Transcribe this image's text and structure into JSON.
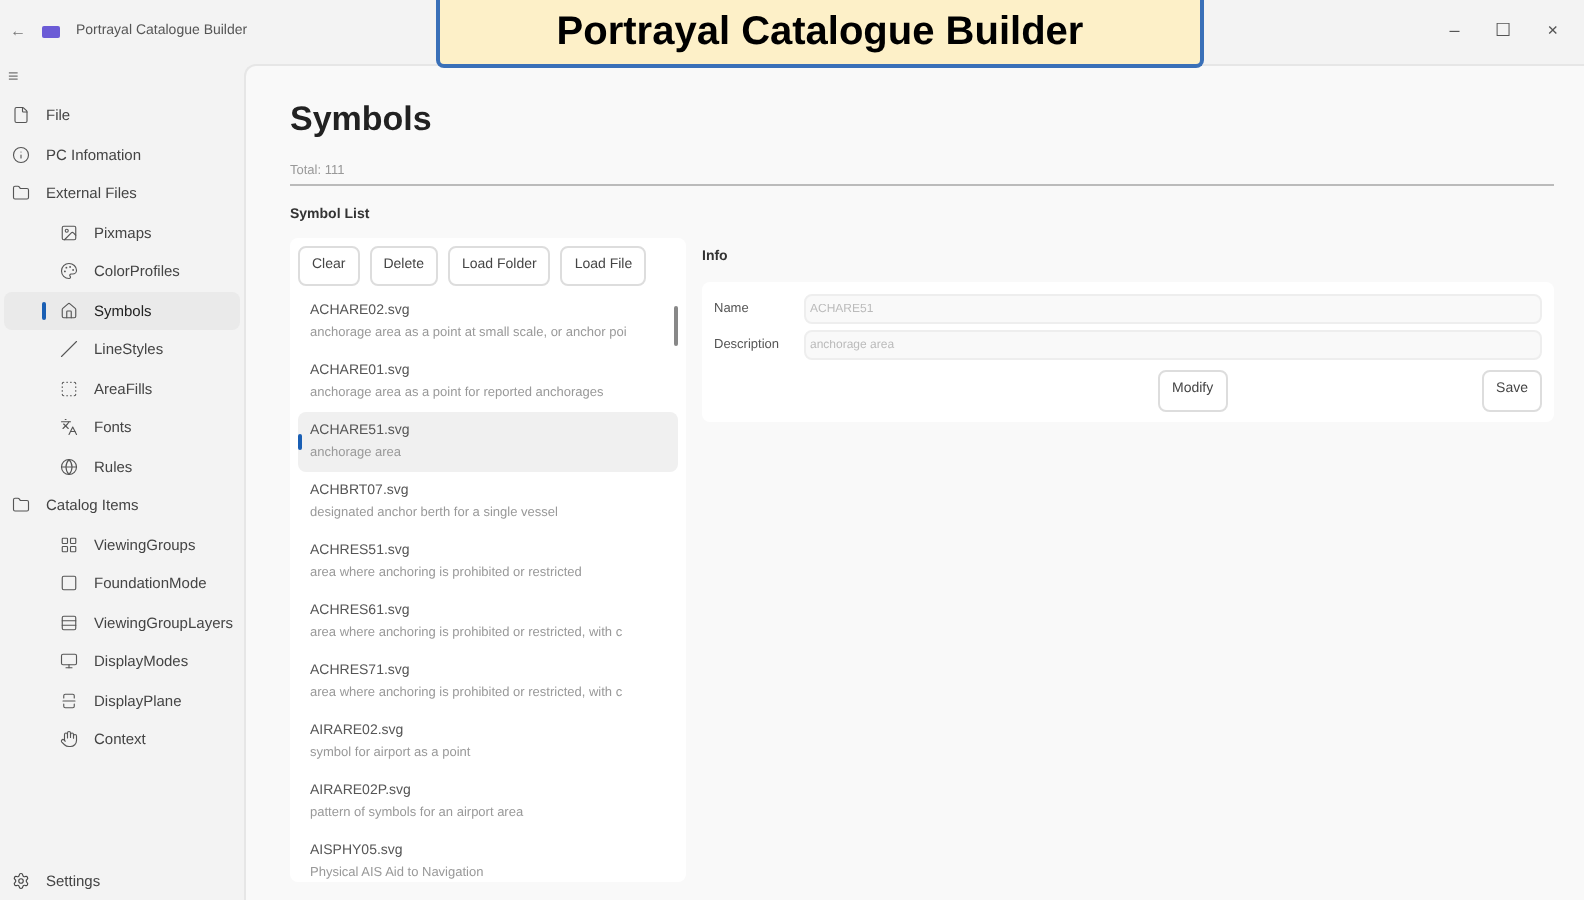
{
  "window": {
    "title": "Portrayal Catalogue Builder",
    "back": "←",
    "controls": [
      "–",
      "☐",
      "×"
    ]
  },
  "banner": "Portrayal Catalogue Builder",
  "sidebar": {
    "menu": "≡",
    "items": [
      {
        "label": "File",
        "kind": "file",
        "selected": false
      },
      {
        "label": "PC Infomation",
        "kind": "info",
        "selected": false
      },
      {
        "label": "External Files",
        "kind": "folder",
        "selected": false,
        "children": [
          {
            "label": "Pixmaps",
            "kind": "pixmap",
            "selected": false
          },
          {
            "label": "ColorProfiles",
            "kind": "palette",
            "selected": false
          },
          {
            "label": "Symbols",
            "kind": "symbol",
            "selected": true
          },
          {
            "label": "LineStyles",
            "kind": "line",
            "selected": false
          },
          {
            "label": "AreaFills",
            "kind": "fill",
            "selected": false
          },
          {
            "label": "Fonts",
            "kind": "font",
            "selected": false
          },
          {
            "label": "Rules",
            "kind": "rules",
            "selected": false
          }
        ]
      },
      {
        "label": "Catalog Items",
        "kind": "folder",
        "selected": false,
        "children": [
          {
            "label": "ViewingGroups",
            "kind": "grid",
            "selected": false
          },
          {
            "label": "FoundationMode",
            "kind": "square",
            "selected": false
          },
          {
            "label": "ViewingGroupLayers",
            "kind": "layers",
            "selected": false
          },
          {
            "label": "DisplayModes",
            "kind": "monitor",
            "selected": false
          },
          {
            "label": "DisplayPlane",
            "kind": "plane",
            "selected": false
          },
          {
            "label": "Context",
            "kind": "context",
            "selected": false
          }
        ]
      }
    ],
    "settings": "Settings"
  },
  "page": {
    "title": "Symbols",
    "total": "Total: 111",
    "list_title": "Symbol List",
    "buttons": [
      "Clear",
      "Delete",
      "Load Folder",
      "Load File"
    ],
    "symbols": [
      {
        "name": "ACHARE02.svg",
        "description": "anchorage area as a point at small scale, or anchor poi",
        "selected": false
      },
      {
        "name": "ACHARE01.svg",
        "description": "anchorage area as a point for reported anchorages",
        "selected": false
      },
      {
        "name": "ACHARE51.svg",
        "description": "anchorage area",
        "selected": true
      },
      {
        "name": "ACHBRT07.svg",
        "description": "designated anchor berth for a single vessel",
        "selected": false
      },
      {
        "name": "ACHRES51.svg",
        "description": "area where anchoring is prohibited or restricted",
        "selected": false
      },
      {
        "name": "ACHRES61.svg",
        "description": "area where anchoring is prohibited or restricted, with c",
        "selected": false
      },
      {
        "name": "ACHRES71.svg",
        "description": "area where anchoring is prohibited or restricted, with c",
        "selected": false
      },
      {
        "name": "AIRARE02.svg",
        "description": "symbol for airport as a point",
        "selected": false
      },
      {
        "name": "AIRARE02P.svg",
        "description": "pattern of symbols for an airport area",
        "selected": false
      },
      {
        "name": "AISPHY05.svg",
        "description": "Physical AIS Aid to Navigation",
        "selected": false
      }
    ],
    "info": {
      "title": "Info",
      "fields": [
        {
          "label": "Name",
          "value": "ACHARE51"
        },
        {
          "label": "Description",
          "value": "anchorage area"
        }
      ],
      "modify": "Modify",
      "save": "Save"
    }
  }
}
